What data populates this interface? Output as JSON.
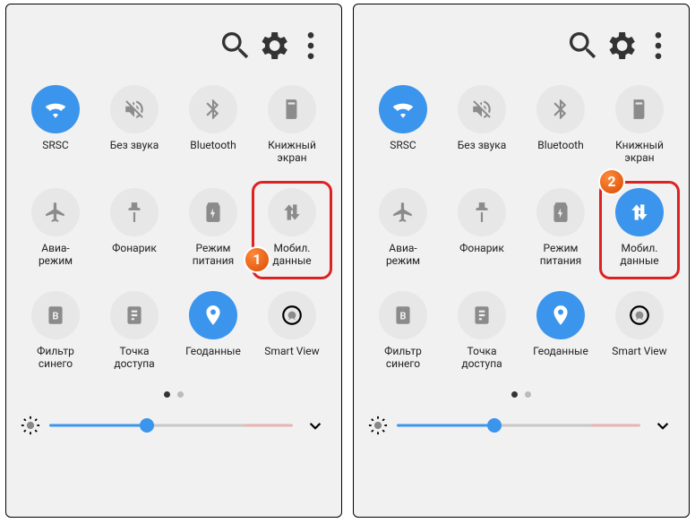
{
  "panels": [
    {
      "mobileDataActive": false,
      "badge": "1",
      "badgePos": "bottom"
    },
    {
      "mobileDataActive": true,
      "badge": "2",
      "badgePos": "top"
    }
  ],
  "tiles": [
    {
      "id": "wifi",
      "label": "SRSC",
      "active": true
    },
    {
      "id": "mute",
      "label": "Без звука",
      "active": false
    },
    {
      "id": "bluetooth",
      "label": "Bluetooth",
      "active": false
    },
    {
      "id": "book",
      "label": "Книжный\nэкран",
      "active": false
    },
    {
      "id": "airplane",
      "label": "Авиа-\nрежим",
      "active": false
    },
    {
      "id": "flashlight",
      "label": "Фонарик",
      "active": false
    },
    {
      "id": "power",
      "label": "Режим\nпитания",
      "active": false
    },
    {
      "id": "mobiledata",
      "label": "Мобил.\nданные",
      "active": false
    },
    {
      "id": "bluelight",
      "label": "Фильтр\nсинего",
      "active": false
    },
    {
      "id": "hotspot",
      "label": "Точка\nдоступа",
      "active": false
    },
    {
      "id": "location",
      "label": "Геоданные",
      "active": true
    },
    {
      "id": "smartview",
      "label": "Smart View",
      "active": false
    }
  ],
  "pager": {
    "total": 2,
    "current": 0
  },
  "brightness": {
    "value": 40
  }
}
